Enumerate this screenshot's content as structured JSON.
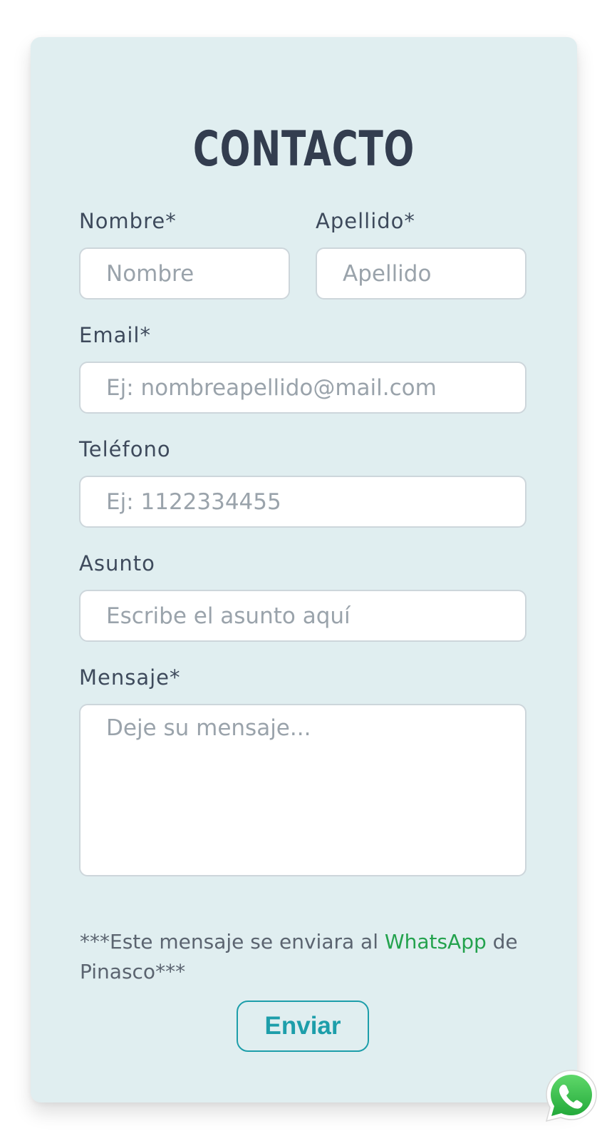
{
  "form": {
    "title": "CONTACTO",
    "fields": {
      "nombre": {
        "label": "Nombre*",
        "placeholder": "Nombre",
        "value": ""
      },
      "apellido": {
        "label": "Apellido*",
        "placeholder": "Apellido",
        "value": ""
      },
      "email": {
        "label": "Email*",
        "placeholder": "Ej: nombreapellido@mail.com",
        "value": ""
      },
      "telefono": {
        "label": "Teléfono",
        "placeholder": "Ej: 1122334455",
        "value": ""
      },
      "asunto": {
        "label": "Asunto",
        "placeholder": "Escribe el asunto aquí",
        "value": ""
      },
      "mensaje": {
        "label": "Mensaje*",
        "placeholder": "Deje su mensaje...",
        "value": ""
      }
    },
    "note": {
      "prefix": "***Este mensaje se enviara al ",
      "link": "WhatsApp",
      "suffix": " de Pinasco***"
    },
    "submit_label": "Enviar"
  },
  "floating_button": {
    "icon": "whatsapp-icon"
  },
  "colors": {
    "card_background": "#e0eef0",
    "title": "#333d4f",
    "label": "#3e4a5c",
    "accent": "#1d9eaa",
    "whatsapp_green": "#23a24d"
  }
}
